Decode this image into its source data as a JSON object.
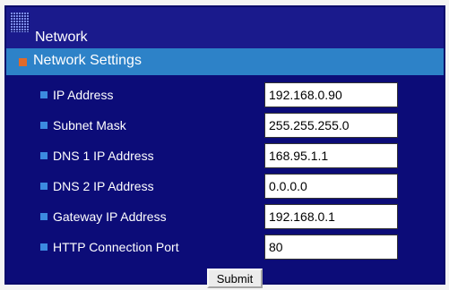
{
  "title": "Network",
  "section": "Network Settings",
  "fields": [
    {
      "label": "IP Address",
      "value": "192.168.0.90"
    },
    {
      "label": "Subnet Mask",
      "value": "255.255.255.0"
    },
    {
      "label": "DNS 1 IP Address",
      "value": "168.95.1.1"
    },
    {
      "label": "DNS 2 IP Address",
      "value": "0.0.0.0"
    },
    {
      "label": "Gateway IP Address",
      "value": "192.168.0.1"
    },
    {
      "label": "HTTP Connection Port",
      "value": "80"
    }
  ],
  "submit_label": "Submit",
  "colors": {
    "title_bar": "#1a1a8c",
    "section_bar": "#2d82c8",
    "content_bg": "#0c0c78",
    "section_bullet": "#e06a2a",
    "row_bullet": "#3c8ae0"
  }
}
